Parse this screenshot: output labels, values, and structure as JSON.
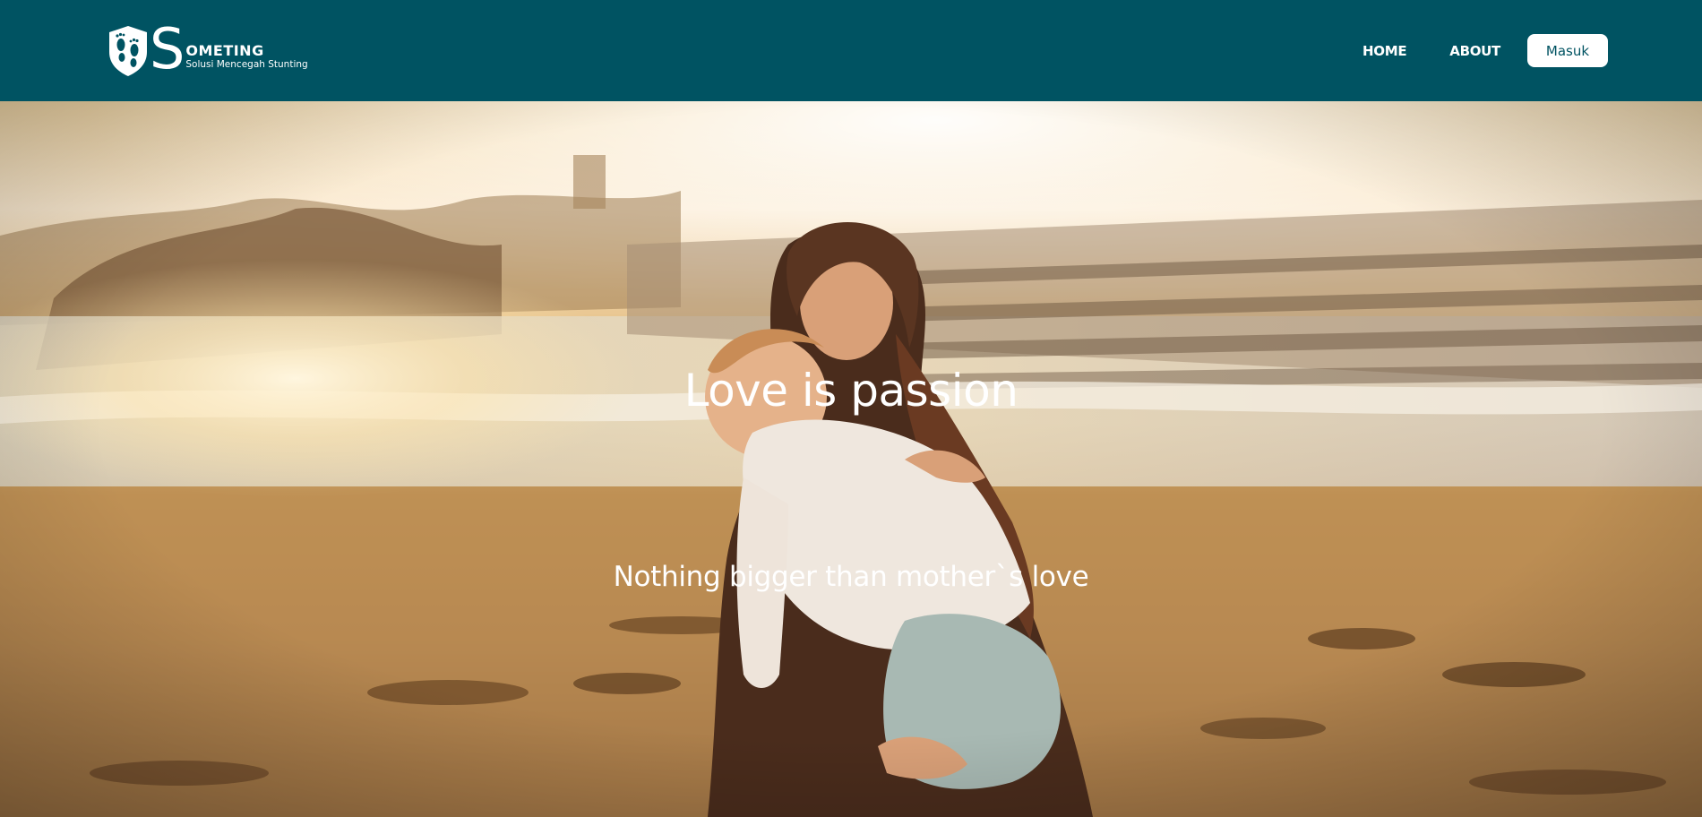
{
  "brand": {
    "letter": "S",
    "name": "OMETING",
    "tagline": "Solusi Mencegah Stunting",
    "icon": "footprints-shield-icon"
  },
  "nav": {
    "home": "HOME",
    "about": "ABOUT",
    "login": "Masuk"
  },
  "hero": {
    "title": "Love is passion",
    "subtitle": "Nothing bigger than mother`s love",
    "image": "mother-hugging-baby-beach-sunset-photo"
  },
  "colors": {
    "navbar": "#005362",
    "button_bg": "#ffffff",
    "button_text": "#005362",
    "text": "#ffffff"
  }
}
